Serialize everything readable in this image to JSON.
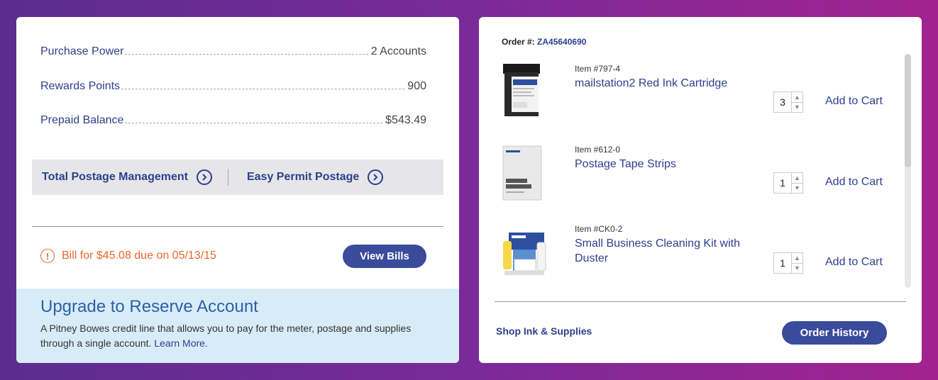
{
  "summary": {
    "purchase_power_label": "Purchase Power",
    "purchase_power_value": "2 Accounts",
    "rewards_points_label": "Rewards Points",
    "rewards_points_value": "900",
    "prepaid_balance_label": "Prepaid Balance",
    "prepaid_balance_value": "$543.49"
  },
  "links": {
    "total_postage_management": "Total Postage Management",
    "easy_permit_postage": "Easy Permit Postage"
  },
  "bill": {
    "text": "Bill for $45.08 due on 05/13/15",
    "icon": "!",
    "button_label": "View Bills"
  },
  "upgrade": {
    "title": "Upgrade to Reserve Account",
    "description": "A Pitney Bowes credit line that allows you to pay for the meter, postage and supplies through a single account.",
    "learn_more": "Learn More."
  },
  "order": {
    "label": "Order #:",
    "number": "ZA45640690"
  },
  "items": [
    {
      "item_number": "Item #797-4",
      "name": "mailstation2 Red Ink Cartridge",
      "quantity": "3",
      "add_label": "Add to Cart"
    },
    {
      "item_number": "Item #612-0",
      "name": "Postage Tape Strips",
      "quantity": "1",
      "add_label": "Add to Cart"
    },
    {
      "item_number": "Item #CK0-2",
      "name": "Small Business Cleaning Kit with Duster",
      "quantity": "1",
      "add_label": "Add to Cart"
    }
  ],
  "footer": {
    "shop_link": "Shop  Ink & Supplies",
    "order_history": "Order History"
  },
  "colors": {
    "brand_blue": "#2d3f8e",
    "button_blue": "#3a4b9c",
    "alert_orange": "#e8692a",
    "upgrade_bg": "#d7ecf7"
  }
}
